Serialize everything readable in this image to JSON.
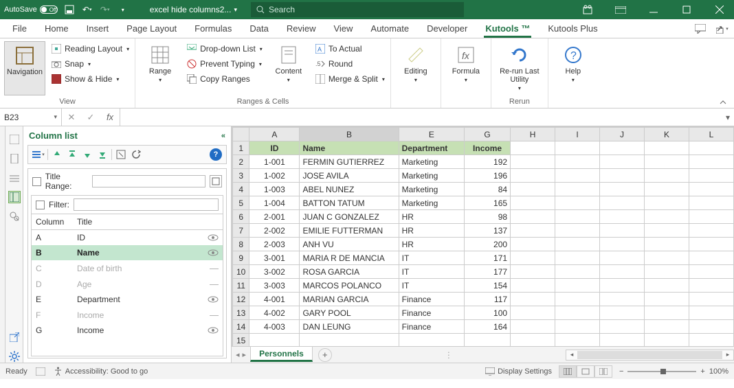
{
  "titlebar": {
    "autosave_label": "AutoSave",
    "autosave_state": "Off",
    "filename": "excel hide columns2...",
    "search_placeholder": "Search"
  },
  "tabs": {
    "items": [
      "File",
      "Home",
      "Insert",
      "Page Layout",
      "Formulas",
      "Data",
      "Review",
      "View",
      "Automate",
      "Developer",
      "Kutools ™",
      "Kutools Plus"
    ],
    "active": "Kutools ™"
  },
  "ribbon": {
    "groups": {
      "view": {
        "label": "View",
        "navigation": "Navigation",
        "reading_layout": "Reading Layout",
        "snap": "Snap",
        "show_hide": "Show & Hide"
      },
      "ranges": {
        "label": "Ranges & Cells",
        "range": "Range",
        "dropdown_list": "Drop-down List",
        "prevent_typing": "Prevent Typing",
        "copy_ranges": "Copy Ranges",
        "content": "Content",
        "to_actual": "To Actual",
        "round": "Round",
        "merge_split": "Merge & Split"
      },
      "editing": {
        "label": "Editing",
        "button": "Editing"
      },
      "formula": {
        "label": "Formula",
        "button": "Formula"
      },
      "rerun": {
        "label": "Rerun",
        "button": "Re-run Last\nUtility"
      },
      "help": {
        "label": "Help",
        "button": "Help"
      }
    }
  },
  "namebox": "B23",
  "column_list": {
    "title": "Column list",
    "title_range_label": "Title Range:",
    "filter_label": "Filter:",
    "header_col": "Column",
    "header_title": "Title",
    "items": [
      {
        "col": "A",
        "title": "ID",
        "visible": true,
        "hidden": false
      },
      {
        "col": "B",
        "title": "Name",
        "visible": true,
        "hidden": false,
        "selected": true
      },
      {
        "col": "C",
        "title": "Date of birth",
        "visible": false,
        "hidden": true
      },
      {
        "col": "D",
        "title": "Age",
        "visible": false,
        "hidden": true
      },
      {
        "col": "E",
        "title": "Department",
        "visible": true,
        "hidden": false
      },
      {
        "col": "F",
        "title": "Income",
        "visible": false,
        "hidden": true
      },
      {
        "col": "G",
        "title": "Income",
        "visible": true,
        "hidden": false
      }
    ]
  },
  "grid": {
    "visible_columns": [
      "A",
      "B",
      "E",
      "G",
      "H",
      "I",
      "J",
      "K",
      "L"
    ],
    "headers": {
      "A": "ID",
      "B": "Name",
      "E": "Department",
      "G": "Income"
    },
    "rows": [
      {
        "n": 2,
        "A": "1-001",
        "B": "FERMIN GUTIERREZ",
        "E": "Marketing",
        "G": 192
      },
      {
        "n": 3,
        "A": "1-002",
        "B": "JOSE AVILA",
        "E": "Marketing",
        "G": 196
      },
      {
        "n": 4,
        "A": "1-003",
        "B": "ABEL NUNEZ",
        "E": "Marketing",
        "G": 84
      },
      {
        "n": 5,
        "A": "1-004",
        "B": "BATTON TATUM",
        "E": "Marketing",
        "G": 165
      },
      {
        "n": 6,
        "A": "2-001",
        "B": "JUAN C GONZALEZ",
        "E": "HR",
        "G": 98
      },
      {
        "n": 7,
        "A": "2-002",
        "B": "EMILIE FUTTERMAN",
        "E": "HR",
        "G": 137
      },
      {
        "n": 8,
        "A": "2-003",
        "B": "ANH VU",
        "E": "HR",
        "G": 200
      },
      {
        "n": 9,
        "A": "3-001",
        "B": "MARIA R DE MANCIA",
        "E": "IT",
        "G": 171
      },
      {
        "n": 10,
        "A": "3-002",
        "B": "ROSA GARCIA",
        "E": "IT",
        "G": 177
      },
      {
        "n": 11,
        "A": "3-003",
        "B": "MARCOS POLANCO",
        "E": "IT",
        "G": 154
      },
      {
        "n": 12,
        "A": "4-001",
        "B": "MARIAN GARCIA",
        "E": "Finance",
        "G": 117
      },
      {
        "n": 13,
        "A": "4-002",
        "B": "GARY POOL",
        "E": "Finance",
        "G": 100
      },
      {
        "n": 14,
        "A": "4-003",
        "B": "DAN LEUNG",
        "E": "Finance",
        "G": 164
      }
    ]
  },
  "sheet_tab": "Personnels",
  "status": {
    "ready": "Ready",
    "accessibility": "Accessibility: Good to go",
    "display_settings": "Display Settings",
    "zoom": "100%"
  }
}
